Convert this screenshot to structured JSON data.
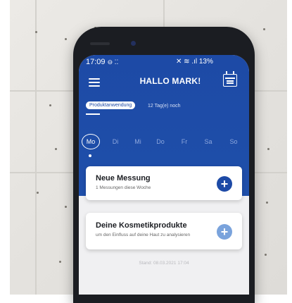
{
  "status_bar": {
    "time": "17:09",
    "status_glyphs": "⊖ ⁚⁚",
    "icons_text": "✕ ≋ .ıl 13%"
  },
  "header": {
    "title": "HALLO MARK!"
  },
  "tabs": {
    "active_pill": "Produktanwendung",
    "countdown": "12 Tag(e) noch"
  },
  "weekdays": [
    "Mo",
    "Di",
    "Mi",
    "Do",
    "Fr",
    "Sa",
    "So"
  ],
  "selected_day_index": 0,
  "cards": [
    {
      "title": "Neue Messung",
      "subtitle": "1 Messungen diese Woche",
      "action": "+"
    },
    {
      "title": "Deine Kosmetikprodukte",
      "subtitle": "um den Einfluss auf deine Haut zu analysieren",
      "action": "+"
    }
  ],
  "footer": {
    "stand": "Stand: 08.03.2021 17:04"
  },
  "colors": {
    "brand_blue": "#1d4aa6",
    "light_blue_button": "#7aa3dc"
  }
}
